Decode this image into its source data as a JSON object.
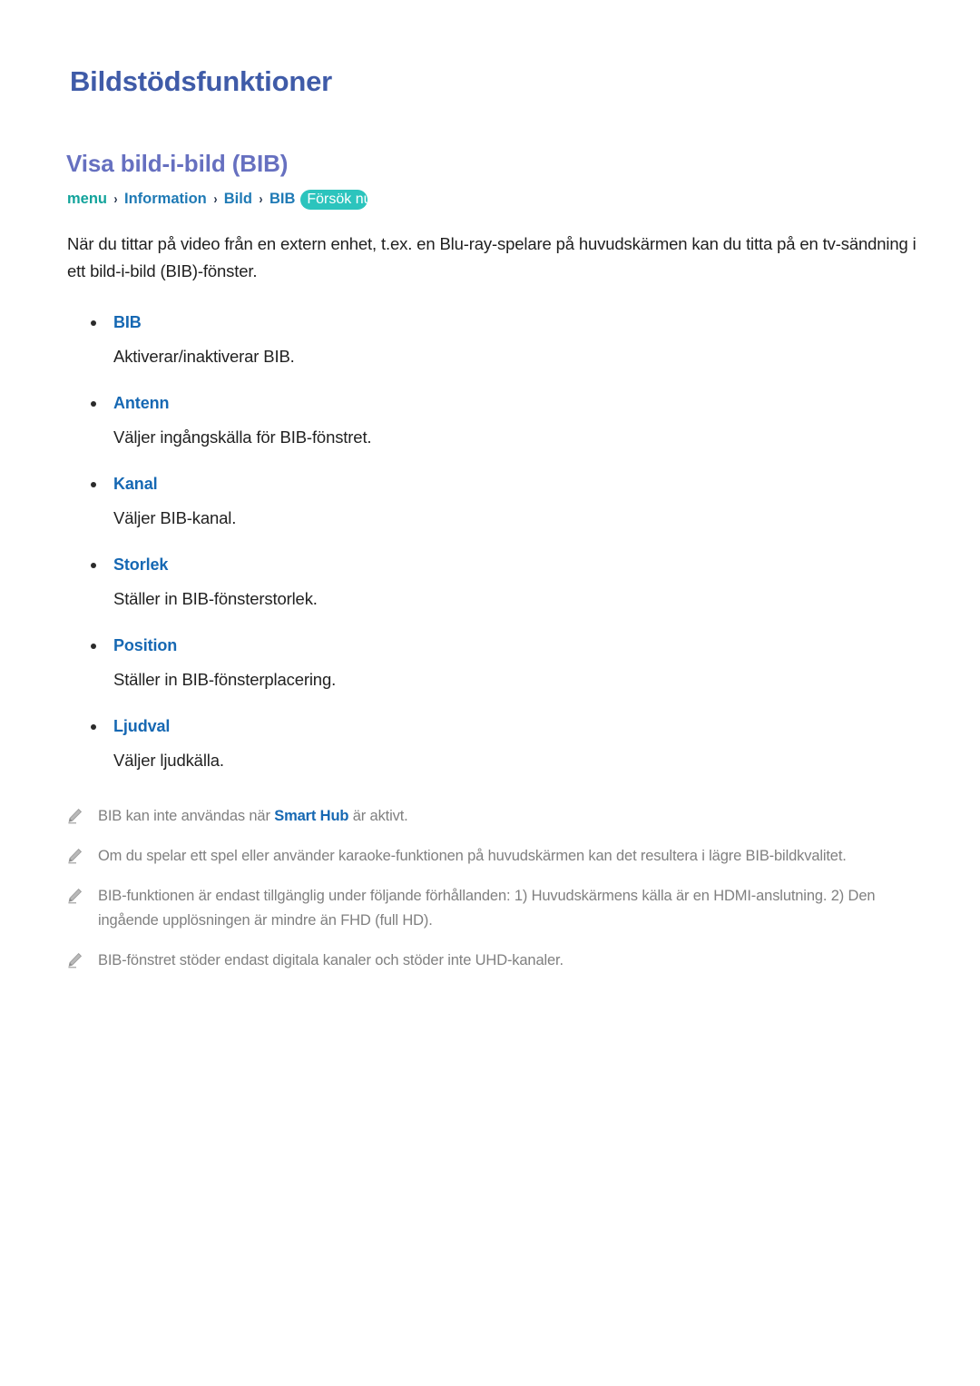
{
  "document": {
    "title": "Bildstödsfunktioner",
    "section_title": "Visa bild-i-bild (BIB)",
    "breadcrumb": {
      "menu": "menu",
      "sep1": "›",
      "item1": "Information",
      "sep2": "›",
      "item2": "Bild",
      "sep3": "›",
      "item3": "BIB",
      "badge": "Försök nu"
    },
    "intro": "När du tittar på video från en extern enhet, t.ex. en Blu-ray-spelare på huvudskärmen kan du titta på en tv-sändning i ett bild-i-bild (BIB)-fönster.",
    "options": [
      {
        "name": "BIB",
        "desc": "Aktiverar/inaktiverar BIB."
      },
      {
        "name": "Antenn",
        "desc": "Väljer ingångskälla för BIB-fönstret."
      },
      {
        "name": "Kanal",
        "desc": "Väljer BIB-kanal."
      },
      {
        "name": "Storlek",
        "desc": "Ställer in BIB-fönsterstorlek."
      },
      {
        "name": "Position",
        "desc": "Ställer in BIB-fönsterplacering."
      },
      {
        "name": "Ljudval",
        "desc": "Väljer ljudkälla."
      }
    ],
    "notes": [
      {
        "icon": "pencil-icon",
        "before": "BIB kan inte användas när ",
        "bold": "Smart Hub",
        "after": " är aktivt."
      },
      {
        "icon": "pencil-icon",
        "before": "Om du spelar ett spel eller använder karaoke-funktionen på huvudskärmen kan det resultera i lägre BIB-bildkvalitet.",
        "bold": "",
        "after": ""
      },
      {
        "icon": "pencil-icon",
        "before": "BIB-funktionen är endast tillgänglig under följande förhållanden: 1) Huvudskärmens källa är en HDMI-anslutning. 2) Den ingående upplösningen är mindre än FHD (full HD).",
        "bold": "",
        "after": ""
      },
      {
        "icon": "pencil-icon",
        "before": "BIB-fönstret stöder endast digitala kanaler och stöder inte UHD-kanaler.",
        "bold": "",
        "after": ""
      }
    ],
    "colors": {
      "page_title": "#3f5ba8",
      "section_title": "#6670c0",
      "option_name": "#1668b3",
      "breadcrumb_menu": "#12a39b",
      "breadcrumb_item": "#1f7ab5",
      "badge_background": "#2cc4bd",
      "note_text": "#808080",
      "body_text": "#1f1f1f"
    }
  }
}
